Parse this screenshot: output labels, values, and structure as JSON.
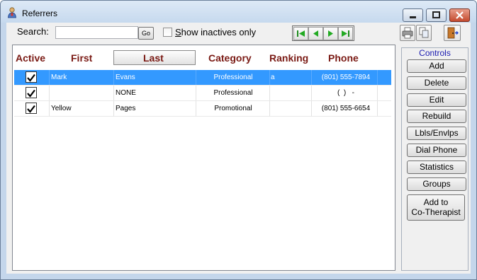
{
  "window": {
    "title": "Referrers"
  },
  "toolbar": {
    "search_label": "Search:",
    "search_value": "",
    "go_label": "Go",
    "show_inactives_label": "Show inactives only",
    "show_inactives_checked": false
  },
  "grid": {
    "columns": [
      "Active",
      "First",
      "Last",
      "Category",
      "Ranking",
      "Phone"
    ],
    "sorted_column": "Last",
    "rows": [
      {
        "active": true,
        "first": "Mark",
        "last": "Evans",
        "category": "Professional",
        "ranking": "a",
        "phone": "(801) 555-7894",
        "selected": true
      },
      {
        "active": true,
        "first": "",
        "last": "NONE",
        "category": "Professional",
        "ranking": "",
        "phone": "(  )   -",
        "selected": false
      },
      {
        "active": true,
        "first": "Yellow",
        "last": "Pages",
        "category": "Promotional",
        "ranking": "",
        "phone": "(801) 555-6654",
        "selected": false
      }
    ]
  },
  "controls": {
    "title": "Controls",
    "buttons": [
      "Add",
      "Delete",
      "Edit",
      "Rebuild",
      "Lbls/Envlps",
      "Dial Phone",
      "Statistics",
      "Groups"
    ],
    "add_to_line1": "Add to",
    "add_to_line2": "Co-Therapist"
  },
  "colors": {
    "selection": "#3399ff",
    "header_text": "#7a1a14",
    "controls_title": "#1b1bb0"
  }
}
